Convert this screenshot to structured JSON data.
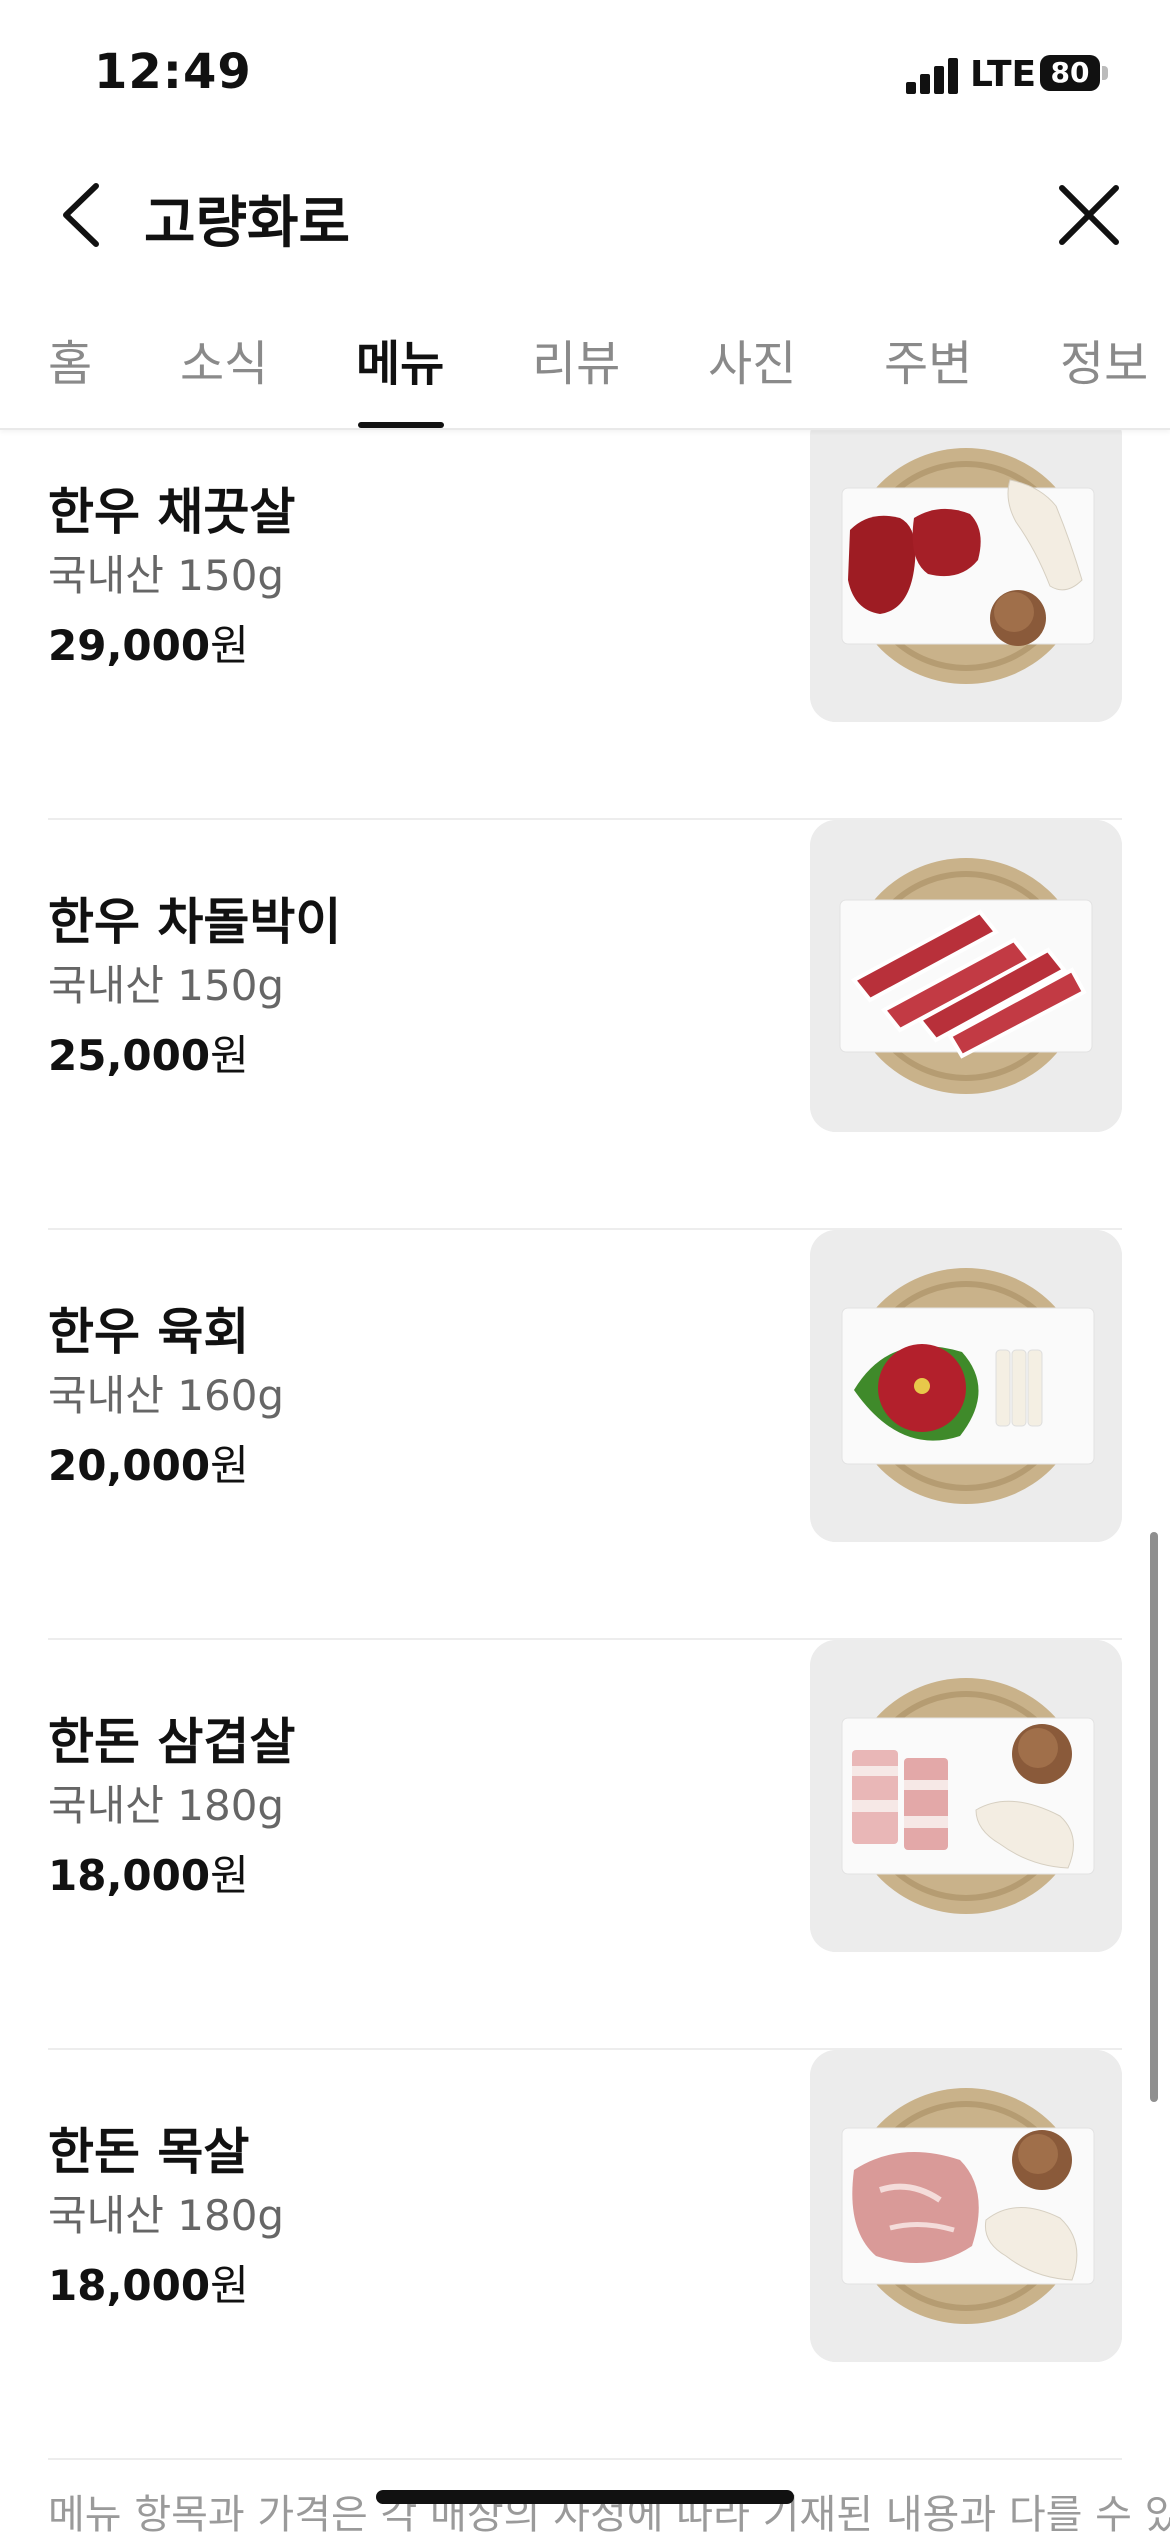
{
  "status_bar": {
    "time": "12:49",
    "network": "LTE",
    "battery": "80"
  },
  "header": {
    "title": "고량화로",
    "back_icon": "chevron-left-icon",
    "close_icon": "close-icon"
  },
  "tabs": [
    {
      "label": "홈"
    },
    {
      "label": "소식"
    },
    {
      "label": "메뉴"
    },
    {
      "label": "리뷰"
    },
    {
      "label": "사진"
    },
    {
      "label": "주변"
    },
    {
      "label": "정보"
    }
  ],
  "active_tab": "메뉴",
  "menu_items": [
    {
      "name": "한우 채끗살",
      "desc": "국내산 150g",
      "price": "29,000",
      "currency": "원"
    },
    {
      "name": "한우 차돌박이",
      "desc": "국내산 150g",
      "price": "25,000",
      "currency": "원"
    },
    {
      "name": "한우 육회",
      "desc": "국내산 160g",
      "price": "20,000",
      "currency": "원"
    },
    {
      "name": "한돈 삼겹살",
      "desc": "국내산 180g",
      "price": "18,000",
      "currency": "원"
    },
    {
      "name": "한돈 목살",
      "desc": "국내산 180g",
      "price": "18,000",
      "currency": "원"
    }
  ],
  "notice": "메뉴 항목과 가격은 각 매장의 사정에 따라 기재된 내용과 다를 수 있",
  "colors": {
    "text": "#111111",
    "muted": "#666666",
    "divider": "#ededed",
    "placemat": "#c9b28a"
  }
}
